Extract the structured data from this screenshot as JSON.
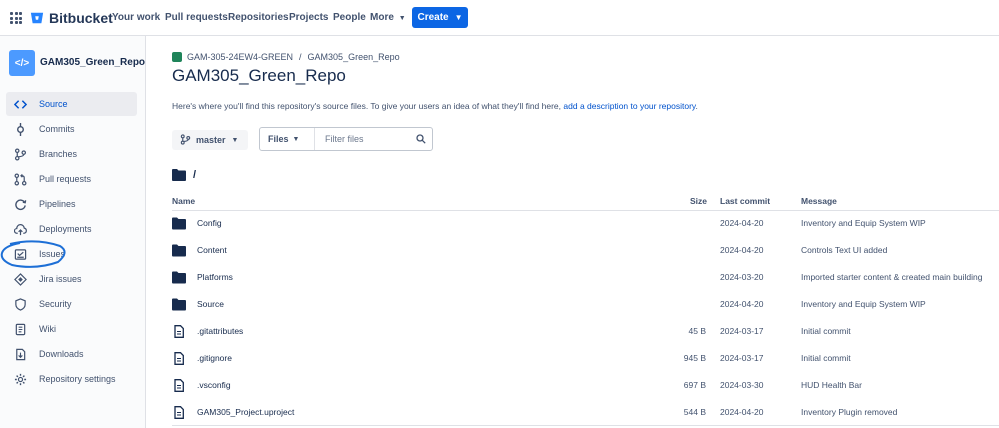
{
  "nav": {
    "brand": "Bitbucket",
    "links": [
      "Your work",
      "Pull requests",
      "Repositories",
      "Projects",
      "People",
      "More"
    ],
    "create_label": "Create"
  },
  "sidebar": {
    "repo_name": "GAM305_Green_Repo",
    "items": [
      {
        "label": "Source",
        "icon": "code-icon",
        "active": true
      },
      {
        "label": "Commits",
        "icon": "commit-icon"
      },
      {
        "label": "Branches",
        "icon": "branch-icon"
      },
      {
        "label": "Pull requests",
        "icon": "pull-request-icon"
      },
      {
        "label": "Pipelines",
        "icon": "pipelines-icon"
      },
      {
        "label": "Deployments",
        "icon": "cloud-upload-icon"
      },
      {
        "label": "Issues",
        "icon": "issues-icon"
      },
      {
        "label": "Jira issues",
        "icon": "jira-icon"
      },
      {
        "label": "Security",
        "icon": "shield-icon"
      },
      {
        "label": "Wiki",
        "icon": "wiki-icon"
      },
      {
        "label": "Downloads",
        "icon": "download-icon"
      },
      {
        "label": "Repository settings",
        "icon": "gear-icon"
      }
    ]
  },
  "breadcrumb": {
    "project": "GAM-305-24EW4-GREEN",
    "separator": "/",
    "repo": "GAM305_Green_Repo"
  },
  "main": {
    "title": "GAM305_Green_Repo",
    "description": "Here's where you'll find this repository's source files. To give your users an idea of what they'll find here,",
    "description_link": "add a description to your repository",
    "branch": "master",
    "files_select": "Files",
    "filter_placeholder": "Filter files",
    "path": "/"
  },
  "table": {
    "headers": {
      "name": "Name",
      "size": "Size",
      "last_commit": "Last commit",
      "message": "Message"
    },
    "rows": [
      {
        "type": "folder",
        "name": "Config",
        "size": "",
        "date": "2024-04-20",
        "message": "Inventory and Equip System WIP"
      },
      {
        "type": "folder",
        "name": "Content",
        "size": "",
        "date": "2024-04-20",
        "message": "Controls Text UI added"
      },
      {
        "type": "folder",
        "name": "Platforms",
        "size": "",
        "date": "2024-03-20",
        "message": "Imported starter content & created main building"
      },
      {
        "type": "folder",
        "name": "Source",
        "size": "",
        "date": "2024-04-20",
        "message": "Inventory and Equip System WIP"
      },
      {
        "type": "file",
        "name": ".gitattributes",
        "size": "45 B",
        "date": "2024-03-17",
        "message": "Initial commit"
      },
      {
        "type": "file",
        "name": ".gitignore",
        "size": "945 B",
        "date": "2024-03-17",
        "message": "Initial commit"
      },
      {
        "type": "file",
        "name": ".vsconfig",
        "size": "697 B",
        "date": "2024-03-30",
        "message": "HUD Health Bar"
      },
      {
        "type": "file",
        "name": "GAM305_Project.uproject",
        "size": "544 B",
        "date": "2024-04-20",
        "message": "Inventory Plugin removed"
      }
    ]
  },
  "colors": {
    "accent": "#0c66e4",
    "link": "#0052cc",
    "annotation": "#1d6fd6",
    "folder": "#172b4d"
  }
}
